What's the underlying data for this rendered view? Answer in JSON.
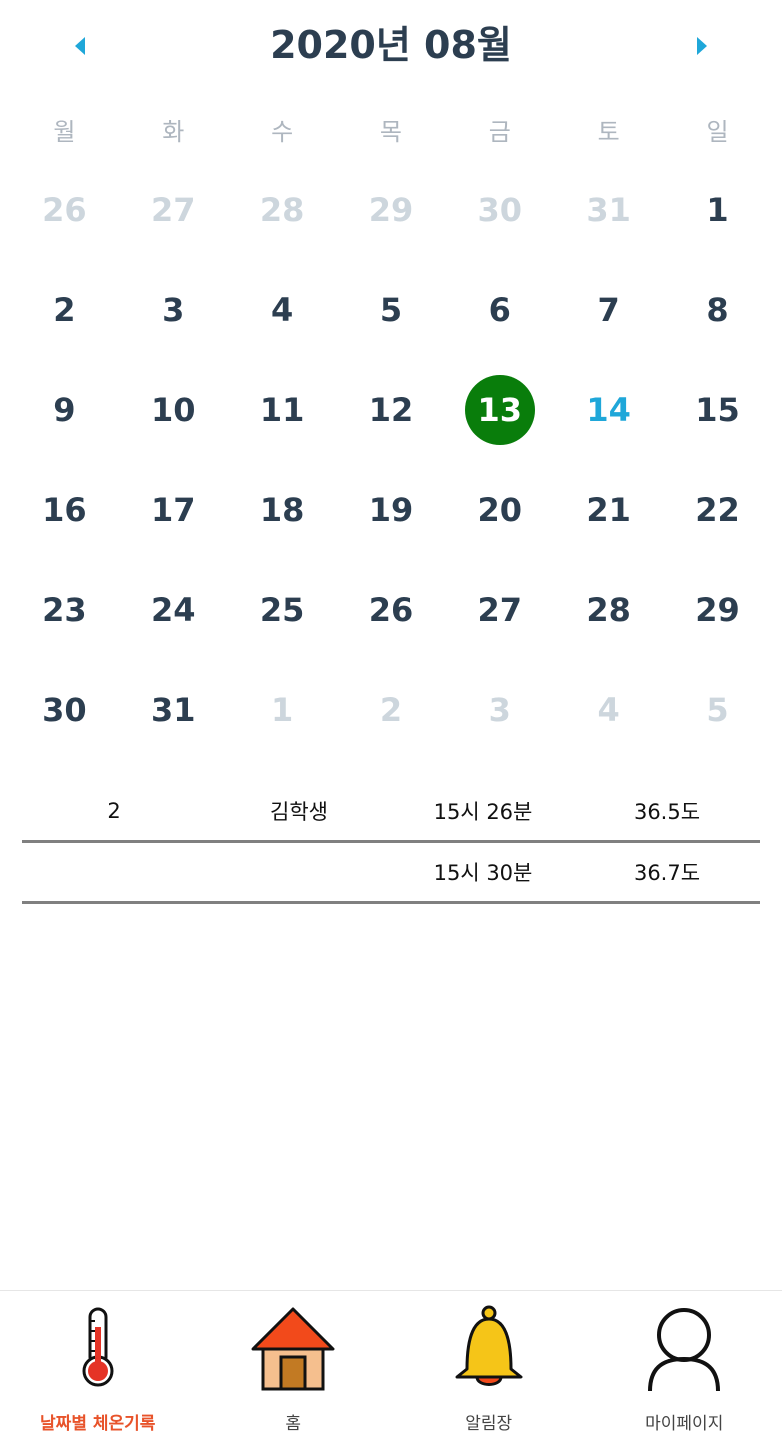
{
  "header": {
    "title": "2020년 08월",
    "prev_icon": "chevron-left-icon",
    "next_icon": "chevron-right-icon",
    "accent_color": "#1fa7d9"
  },
  "weekdays": [
    "월",
    "화",
    "수",
    "목",
    "금",
    "토",
    "일"
  ],
  "weeks": [
    [
      {
        "d": "26",
        "m": true
      },
      {
        "d": "27",
        "m": true
      },
      {
        "d": "28",
        "m": true
      },
      {
        "d": "29",
        "m": true
      },
      {
        "d": "30",
        "m": true
      },
      {
        "d": "31",
        "m": true
      },
      {
        "d": "1"
      }
    ],
    [
      {
        "d": "2"
      },
      {
        "d": "3"
      },
      {
        "d": "4"
      },
      {
        "d": "5"
      },
      {
        "d": "6"
      },
      {
        "d": "7"
      },
      {
        "d": "8"
      }
    ],
    [
      {
        "d": "9"
      },
      {
        "d": "10"
      },
      {
        "d": "11"
      },
      {
        "d": "12"
      },
      {
        "d": "13",
        "selected": true
      },
      {
        "d": "14",
        "accent": true
      },
      {
        "d": "15"
      }
    ],
    [
      {
        "d": "16"
      },
      {
        "d": "17"
      },
      {
        "d": "18"
      },
      {
        "d": "19"
      },
      {
        "d": "20"
      },
      {
        "d": "21"
      },
      {
        "d": "22"
      }
    ],
    [
      {
        "d": "23"
      },
      {
        "d": "24"
      },
      {
        "d": "25"
      },
      {
        "d": "26"
      },
      {
        "d": "27"
      },
      {
        "d": "28"
      },
      {
        "d": "29"
      }
    ],
    [
      {
        "d": "30"
      },
      {
        "d": "31"
      },
      {
        "d": "1",
        "m": true
      },
      {
        "d": "2",
        "m": true
      },
      {
        "d": "3",
        "m": true
      },
      {
        "d": "4",
        "m": true
      },
      {
        "d": "5",
        "m": true
      }
    ]
  ],
  "selected_color": "#097d0b",
  "records": [
    {
      "number": "2",
      "name": "김학생",
      "time": "15시 26분",
      "temp": "36.5도"
    },
    {
      "number": "",
      "name": "",
      "time": "15시 30분",
      "temp": "36.7도"
    }
  ],
  "bottom_nav": [
    {
      "label": "날짜별 체온기록",
      "icon": "thermometer-icon",
      "active": true
    },
    {
      "label": "홈",
      "icon": "house-icon",
      "active": false
    },
    {
      "label": "알림장",
      "icon": "bell-icon",
      "active": false
    },
    {
      "label": "마이페이지",
      "icon": "person-icon",
      "active": false
    }
  ]
}
